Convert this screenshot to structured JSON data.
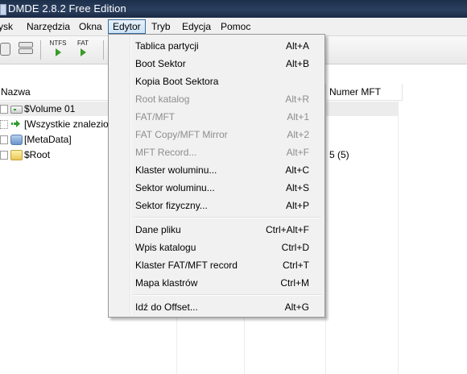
{
  "window": {
    "title": "DMDE 2.8.2 Free Edition"
  },
  "menubar": {
    "items": [
      {
        "label": "Dysk",
        "visible": "ysk"
      },
      {
        "label": "Narzędzia"
      },
      {
        "label": "Okna"
      },
      {
        "label": "Edytor"
      },
      {
        "label": "Tryb"
      },
      {
        "label": "Edycja"
      },
      {
        "label": "Pomoc"
      }
    ]
  },
  "toolbar": {
    "ntfs_label": "NTFS",
    "fat_label": "FAT"
  },
  "list": {
    "columns": {
      "name": "Nazwa",
      "mft": "Numer MFT"
    },
    "rows": [
      {
        "name": "$Volume 01"
      },
      {
        "name": "[Wszystkie znalezion"
      },
      {
        "name": "[MetaData]"
      },
      {
        "name": "$Root",
        "mft": "5 (5)"
      }
    ]
  },
  "editor_menu": {
    "items": [
      {
        "label": "Tablica partycji",
        "shortcut": "Alt+A",
        "disabled": false
      },
      {
        "label": "Boot Sektor",
        "shortcut": "Alt+B",
        "disabled": false
      },
      {
        "label": "Kopia Boot Sektora",
        "shortcut": "",
        "disabled": false
      },
      {
        "label": "Root katalog",
        "shortcut": "Alt+R",
        "disabled": true
      },
      {
        "label": "FAT/MFT",
        "shortcut": "Alt+1",
        "disabled": true
      },
      {
        "label": "FAT Copy/MFT Mirror",
        "shortcut": "Alt+2",
        "disabled": true
      },
      {
        "label": "MFT Record...",
        "shortcut": "Alt+F",
        "disabled": true
      },
      {
        "label": "Klaster woluminu...",
        "shortcut": "Alt+C",
        "disabled": false
      },
      {
        "label": "Sektor woluminu...",
        "shortcut": "Alt+S",
        "disabled": false
      },
      {
        "label": "Sektor fizyczny...",
        "shortcut": "Alt+P",
        "disabled": false
      },
      {
        "label": "Dane pliku",
        "shortcut": "Ctrl+Alt+F",
        "disabled": false
      },
      {
        "label": "Wpis katalogu",
        "shortcut": "Ctrl+D",
        "disabled": false
      },
      {
        "label": "Klaster FAT/MFT record",
        "shortcut": "Ctrl+T",
        "disabled": false
      },
      {
        "label": "Mapa klastrów",
        "shortcut": "Ctrl+M",
        "disabled": false
      },
      {
        "label": "Idź do Offset...",
        "shortcut": "Alt+G",
        "disabled": false
      }
    ]
  }
}
